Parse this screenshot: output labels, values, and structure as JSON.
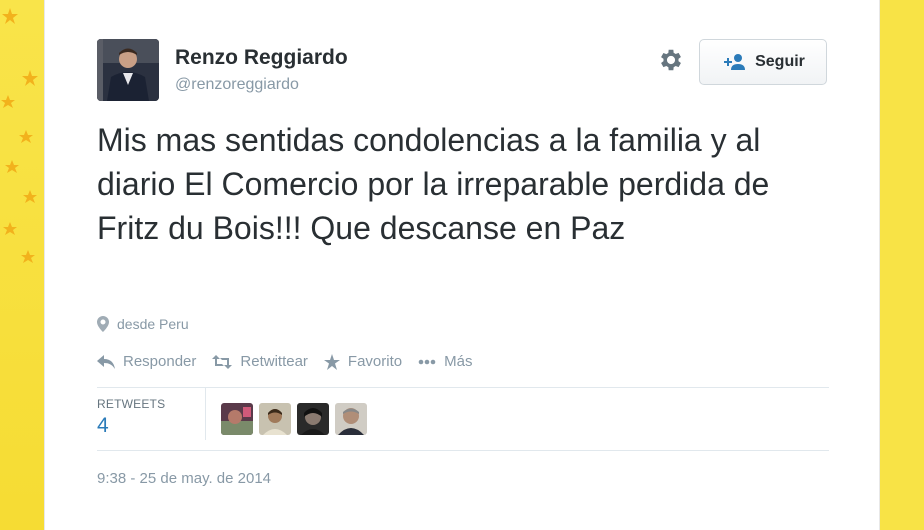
{
  "user": {
    "name": "Renzo Reggiardo",
    "handle": "@renzoreggiardo"
  },
  "header": {
    "follow_label": "Seguir"
  },
  "tweet": {
    "text": "Mis mas sentidas condolencias a la familia y al diario El Comercio por la irreparable perdida de Fritz du Bois!!! Que descanse en Paz",
    "location": "desde Peru",
    "timestamp": "9:38 - 25 de may. de 2014"
  },
  "actions": [
    {
      "label": "Responder",
      "icon": "reply-icon"
    },
    {
      "label": "Retwittear",
      "icon": "retweet-icon"
    },
    {
      "label": "Favorito",
      "icon": "star-icon"
    },
    {
      "label": "Más",
      "icon": "more-icon"
    }
  ],
  "stats": {
    "retweets_label": "RETWEETS",
    "retweets_count": "4"
  },
  "colors": {
    "background": "#f7e13e",
    "link": "#2b7bb9",
    "muted": "#8899a6",
    "text": "#292f33"
  }
}
